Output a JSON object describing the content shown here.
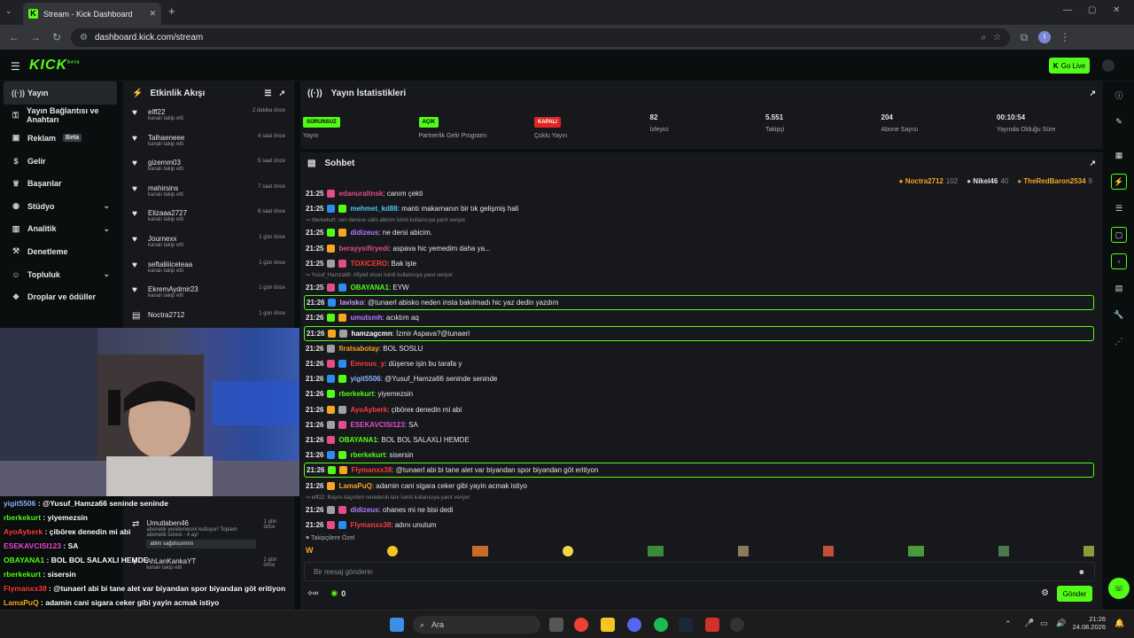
{
  "browser": {
    "tab_title": "Stream - Kick Dashboard",
    "url": "dashboard.kick.com/stream",
    "profile_initial": "I"
  },
  "app": {
    "logo": "KICK",
    "logo_sup": "beta",
    "golive": "Go Live"
  },
  "nav": [
    {
      "label": "Yayın",
      "icon": "broadcast-icon",
      "active": true
    },
    {
      "label": "Yayın Bağlantısı ve Anahtarı",
      "icon": "key-icon"
    },
    {
      "label": "Reklam",
      "badge": "Beta",
      "icon": "ad-icon"
    },
    {
      "label": "Gelir",
      "icon": "dollar-icon"
    },
    {
      "label": "Başarılar",
      "icon": "trophy-icon"
    },
    {
      "label": "Stüdyo",
      "icon": "studio-icon",
      "chevron": true
    },
    {
      "label": "Analitik",
      "icon": "chart-icon",
      "chevron": true
    },
    {
      "label": "Denetleme",
      "icon": "hammer-icon"
    },
    {
      "label": "Topluluk",
      "icon": "community-icon",
      "chevron": true
    },
    {
      "label": "Droplar ve ödüller",
      "icon": "gift-icon"
    }
  ],
  "activity": {
    "title": "Etkinlik Akışı",
    "items": [
      {
        "name": "elff22",
        "sub": "kanalı takip etti",
        "time": "2 dakika önce"
      },
      {
        "name": "Talhaeneee",
        "sub": "kanalı takip etti",
        "time": "4 saat önce"
      },
      {
        "name": "gizemm03",
        "sub": "kanalı takip etti",
        "time": "5 saat önce"
      },
      {
        "name": "mahirsins",
        "sub": "kanalı takip etti",
        "time": "7 saat önce"
      },
      {
        "name": "Elizaaa2727",
        "sub": "kanalı takip etti",
        "time": "8 saat önce"
      },
      {
        "name": "Journexx",
        "sub": "kanalı takip etti",
        "time": "1 gün önce"
      },
      {
        "name": "seftaliiiiceteaa",
        "sub": "kanalı takip etti",
        "time": "1 gün önce"
      },
      {
        "name": "EkremAydmir23",
        "sub": "kanalı takip etti",
        "time": "1 gün önce"
      },
      {
        "name": "Noctra2712",
        "sub": "",
        "time": "1 gün önce"
      }
    ],
    "lower": [
      {
        "name": "Umutlaben46",
        "sub": "abonelik yenilemesini kutluyor! Toplam abonelik süresi - 4 ay!",
        "msg": "abim sağolsunnnn",
        "time": "1 gün önce"
      },
      {
        "name": "AhLanKankaYT",
        "sub": "kanalı takip etti",
        "time": "1 gün önce"
      }
    ]
  },
  "stats": {
    "title": "Yayın İstatistikleri",
    "items": [
      {
        "pill": "SORUNSUZ",
        "label": "Yayın"
      },
      {
        "pill": "AÇIK",
        "label": "Partnerlik Gelir Programı"
      },
      {
        "pill": "KAPALI",
        "label": "Çoklu Yayın"
      },
      {
        "value": "82",
        "label": "İzleyici"
      },
      {
        "value": "5.551",
        "label": "Takipçi"
      },
      {
        "value": "204",
        "label": "Abone Sayısı"
      },
      {
        "value": "00:10:54",
        "label": "Yayında Olduğu Süre"
      }
    ]
  },
  "chat": {
    "title": "Sohbet",
    "leaders": [
      {
        "name": "Noctra2712",
        "n": "102"
      },
      {
        "name": "Nikel46",
        "n": "40"
      },
      {
        "name": "TheRedBaron2534",
        "n": "9"
      }
    ],
    "lines": [
      {
        "t": "21:25",
        "u": "edanuraltnsk",
        "c": "#e64b8a",
        "m": ": canım çekti"
      },
      {
        "t": "21:25",
        "u": "mehmet_kd88",
        "c": "#4fc3f7",
        "m": ": mantı makarnanın bir tık gelişmiş hali"
      },
      {
        "t": "21:25",
        "u": "didizeus",
        "c": "#b27cff",
        "m": ": ne dersi abicim.",
        "reply": "rberkekurt: sen dersine calis abicim İsimli kullanıcıya yanıt veriyor"
      },
      {
        "t": "21:25",
        "u": "berayysifiryedi",
        "c": "#e64b8a",
        "m": ": aspava hic yemedim daha ya..."
      },
      {
        "t": "21:25",
        "u": "TOXICERO",
        "c": "#ff3b3b",
        "m": ": Bak işte"
      },
      {
        "t": "21:25",
        "u": "OBAYANA1",
        "c": "#53fc18",
        "m": ": EYW",
        "reply": "Yusuf_Hamza66: Afiyed olsun İsimli kullanıcıya yanıt veriyor"
      },
      {
        "t": "21:26",
        "u": "lavisko",
        "c": "#c7a0ff",
        "m": ": @tunaerl abisko neden insta bakılmadı hic yaz dedin yazdım",
        "hl": true
      },
      {
        "t": "21:26",
        "u": "umutsmh",
        "c": "#b27cff",
        "m": ": acıktım aq"
      },
      {
        "t": "21:26",
        "u": "hamzagcmn",
        "c": "#ffffff",
        "m": ": İzmir Aspava?@tunaerl",
        "hl": true
      },
      {
        "t": "21:26",
        "u": "firatsabotay",
        "c": "#f5a623",
        "m": ": BOL SOSLU"
      },
      {
        "t": "21:26",
        "u": "Emrous_y",
        "c": "#ff3b3b",
        "m": ": düşerse işin bu tarafa y"
      },
      {
        "t": "21:26",
        "u": "yigit5506",
        "c": "#8ab4ff",
        "m": ": @Yusuf_Hamza66 seninde seninde"
      },
      {
        "t": "21:26",
        "u": "rberkekurt",
        "c": "#53fc18",
        "m": ": yiyemezsin"
      },
      {
        "t": "21:26",
        "u": "AyoAyberk",
        "c": "#ff3b3b",
        "m": ": çiböreк denedin mi abi"
      },
      {
        "t": "21:26",
        "u": "ESEKAVCISI123",
        "c": "#e64bd0",
        "m": ": SA"
      },
      {
        "t": "21:26",
        "u": "OBAYANA1",
        "c": "#53fc18",
        "m": ": BOL BOL SALAXLI HEMDE"
      },
      {
        "t": "21:26",
        "u": "rberkekurt",
        "c": "#53fc18",
        "m": ": sisersin"
      },
      {
        "t": "21:26",
        "u": "Flymanxx38",
        "c": "#ff3b3b",
        "m": ": @tunaerl abi bi tane alet var biyandan spor biyandan göt eritiyon",
        "hl": true
      },
      {
        "t": "21:26",
        "u": "LamaPuQ",
        "c": "#f5a623",
        "m": ": adamin cani sigara ceker gibi yayin acmak istiyo"
      },
      {
        "t": "21:26",
        "u": "didizeus",
        "c": "#b27cff",
        "m": ": ohanes mi ne bisi dedi",
        "reply": "elff22: Başını kaçırdım neredesin lanı İsimli kullanıcıya yanıt veriyor"
      },
      {
        "t": "21:26",
        "u": "Flymanxx38",
        "c": "#ff3b3b",
        "m": ": adını unutum"
      }
    ],
    "followers_only": "Takipçilere Özel",
    "placeholder": "Bir mesaj gönderin",
    "points": "0",
    "send": "Gönder"
  },
  "overlay": [
    {
      "u": "yigit5506",
      "c": "#8ab4ff",
      "m": " : @Yusuf_Hamza66 seninde seninde"
    },
    {
      "u": "rberkekurt",
      "c": "#53fc18",
      "m": " : yiyemezsin"
    },
    {
      "u": "AyoAyberk",
      "c": "#ff3b3b",
      "m": " : çiböreк denedin mi abi"
    },
    {
      "u": "ESEKAVCISI123",
      "c": "#e64bd0",
      "m": " : SA"
    },
    {
      "u": "OBAYANA1",
      "c": "#53fc18",
      "m": " : BOL BOL SALAXLI HEMDE"
    },
    {
      "u": "rberkekurt",
      "c": "#53fc18",
      "m": " : sisersin"
    },
    {
      "u": "Flymanxx38",
      "c": "#ff3b3b",
      "m": " : @tunaerl abi bi tane alet var biyandan spor biyandan göt eritiyon"
    },
    {
      "u": "LamaPuQ",
      "c": "#f5a623",
      "m": " : adamin cani sigara ceker gibi yayin acmak istiyo"
    },
    {
      "u": "didizeus",
      "c": "#b27cff",
      "m": " : ohanes mi ne bisi dedi"
    },
    {
      "u": "Flymanxx38",
      "c": "#ff3b3b",
      "m": " : adını unutum"
    }
  ],
  "taskbar": {
    "search": "Ara",
    "time": "21:26",
    "date": "24.08.2026"
  },
  "colors": {
    "accent": "#53fc18",
    "bg": "#0b0e0f",
    "panel": "#16181b"
  }
}
